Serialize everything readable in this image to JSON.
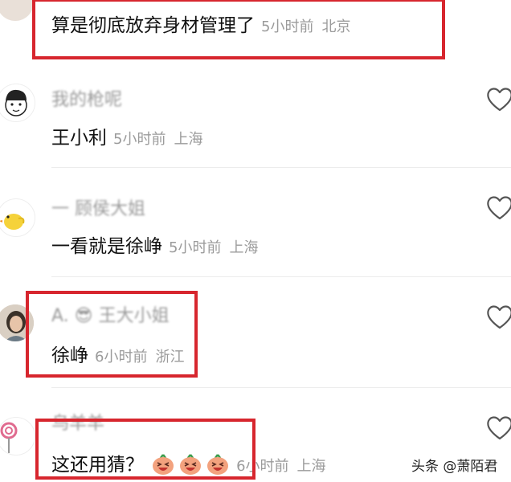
{
  "comments": [
    {
      "username": "",
      "text": "算是彻底放弃身材管理了",
      "time": "5小时前",
      "location": "北京"
    },
    {
      "username": "我的枪呢",
      "text": "王小利",
      "time": "5小时前",
      "location": "上海"
    },
    {
      "username": "一 顾侯大姐",
      "text": "一看就是徐峥",
      "time": "5小时前",
      "location": "上海"
    },
    {
      "username": "A. 😎 王大小姐",
      "text": "徐峥",
      "time": "6小时前",
      "location": "浙江"
    },
    {
      "username": "乌羊羊",
      "text": "这还用猜？",
      "time": "6小时前",
      "location": "上海"
    }
  ],
  "watermark": "头条 @萧陌君",
  "colors": {
    "highlight": "#d7262e",
    "meta": "#9b9b9b"
  },
  "icons": [
    "heart-outline-icon",
    "laughing-emoji-icon"
  ]
}
